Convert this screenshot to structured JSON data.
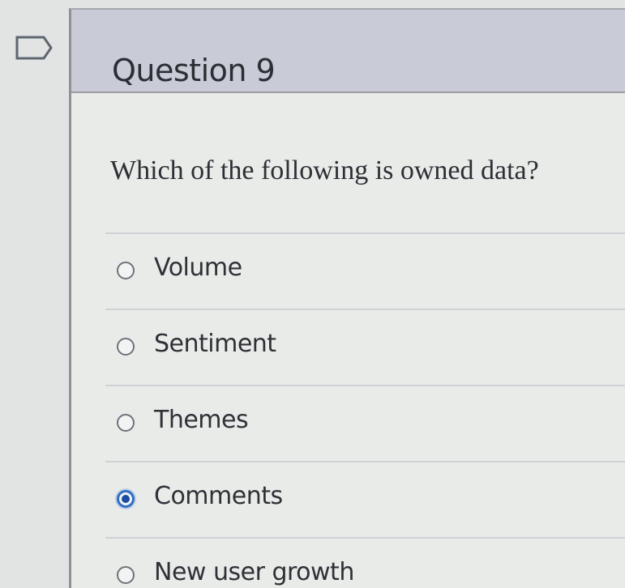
{
  "flag": {
    "icon": "flag-question-icon"
  },
  "question": {
    "title": "Question 9",
    "text": "Which of the following is owned data?",
    "options": [
      {
        "label": "Volume",
        "selected": false
      },
      {
        "label": "Sentiment",
        "selected": false
      },
      {
        "label": "Themes",
        "selected": false
      },
      {
        "label": "Comments",
        "selected": true
      },
      {
        "label": "New user growth",
        "selected": false
      }
    ]
  },
  "colors": {
    "header_background": "#c9cbd6",
    "selected_radio": "#2f6ec7"
  }
}
